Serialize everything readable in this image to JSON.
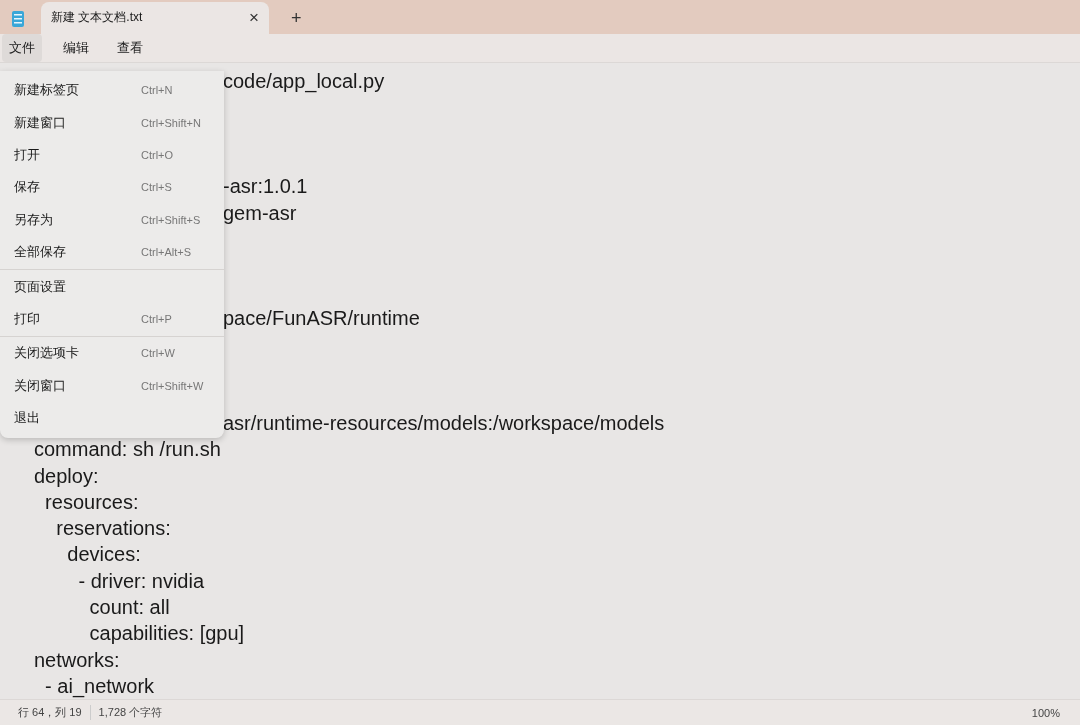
{
  "tabs": [
    {
      "title": "新建 文本文档.txt",
      "close": "×",
      "selected": true
    }
  ],
  "new_tab": "+",
  "menu_bar": [
    {
      "label": "文件",
      "selected": true
    },
    {
      "label": "编辑",
      "selected": false
    },
    {
      "label": "查看",
      "selected": false
    }
  ],
  "file_menu": [
    {
      "label": "新建标签页",
      "shortcut": "Ctrl+N",
      "group_start": false
    },
    {
      "label": "新建窗口",
      "shortcut": "Ctrl+Shift+N",
      "group_start": false
    },
    {
      "label": "打开",
      "shortcut": "Ctrl+O",
      "group_start": false
    },
    {
      "label": "保存",
      "shortcut": "Ctrl+S",
      "group_start": false
    },
    {
      "label": "另存为",
      "shortcut": "Ctrl+Shift+S",
      "group_start": false
    },
    {
      "label": "全部保存",
      "shortcut": "Ctrl+Alt+S",
      "group_start": false
    },
    {
      "label": "页面设置",
      "group_start": true
    },
    {
      "label": "打印",
      "shortcut": "Ctrl+P",
      "group_start": false
    },
    {
      "label": "关闭选项卡",
      "shortcut": "Ctrl+W",
      "group_start": true
    },
    {
      "label": "关闭窗口",
      "shortcut": "Ctrl+Shift+W",
      "group_start": false
    },
    {
      "label": "退出",
      "group_start": false
    }
  ],
  "editor_lines": [
    {
      "kind": "clipped",
      "text": "code/app_local.py"
    },
    {
      "kind": "blank"
    },
    {
      "kind": "blank"
    },
    {
      "kind": "blank"
    },
    {
      "kind": "clipped",
      "text": "-asr:1.0.1"
    },
    {
      "kind": "clipped",
      "text": "gem-asr"
    },
    {
      "kind": "blank"
    },
    {
      "kind": "blank"
    },
    {
      "kind": "blank"
    },
    {
      "kind": "clipped",
      "text": "pace/FunASR/runtime"
    },
    {
      "kind": "blank"
    },
    {
      "kind": "blank"
    },
    {
      "kind": "blank"
    },
    {
      "kind": "clipped",
      "text": "asr/runtime-resources/models:/workspace/models"
    },
    {
      "kind": "full",
      "text": "command: sh /run.sh"
    },
    {
      "kind": "full",
      "text": "deploy:"
    },
    {
      "kind": "full",
      "text": "  resources:"
    },
    {
      "kind": "full",
      "text": "    reservations:"
    },
    {
      "kind": "full",
      "text": "      devices:"
    },
    {
      "kind": "full",
      "text": "        - driver: nvidia"
    },
    {
      "kind": "full",
      "text": "          count: all"
    },
    {
      "kind": "full",
      "text": "          capabilities: [gpu]"
    },
    {
      "kind": "full",
      "text": "networks:"
    },
    {
      "kind": "full",
      "text": "  - ai_network"
    }
  ],
  "status_bar": {
    "position": "行 64，列 19",
    "characters": "1,728 个字符",
    "zoom": "100%"
  }
}
